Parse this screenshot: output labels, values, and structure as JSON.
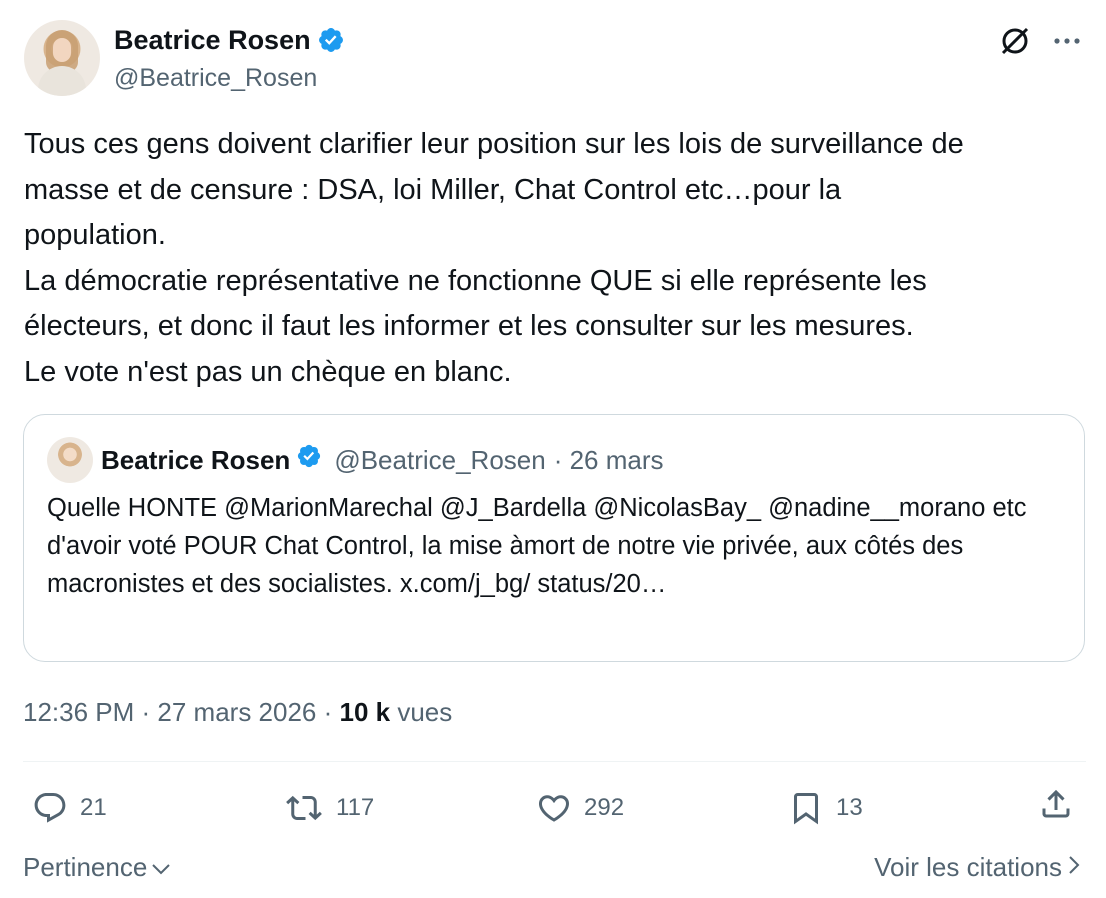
{
  "author": {
    "name": "Beatrice Rosen",
    "handle": "@Beatrice_Rosen"
  },
  "tweet": {
    "text": "Tous ces gens doivent clarifier leur position sur les lois de surveillance de\nmasse  et de censure : DSA, loi Miller, Chat Control etc…pour la\npopulation.\nLa démocratie représentative ne fonctionne QUE si elle représente les\nélecteurs, et donc il faut les informer et les consulter sur les mesures.\nLe vote n'est pas un chèque en blanc."
  },
  "quoted": {
    "name": "Beatrice Rosen",
    "handle": "@Beatrice_Rosen",
    "date": "· 26 mars",
    "text": "Quelle HONTE @MarionMarechal @J_Bardella @NicolasBay_ @nadine__morano etc d'avoir voté POUR Chat Control, la mise àmort de notre vie privée, aux côtés des macronistes et des socialistes. x.com/j_bg/\nstatus/20…"
  },
  "meta": {
    "time_date": "12:36 PM · 27 mars 2026 ·",
    "views_count": "10 k",
    "views_label": "vues"
  },
  "actions": {
    "replies": "21",
    "retweets": "117",
    "likes": "292",
    "bookmarks": "13"
  },
  "footer": {
    "sort_label": "Pertinence",
    "quotes_link": "Voir les citations"
  },
  "colors": {
    "verified": "#1d9bf0",
    "text": "#0f1419",
    "secondary": "#536471",
    "border": "#cfd9de"
  }
}
